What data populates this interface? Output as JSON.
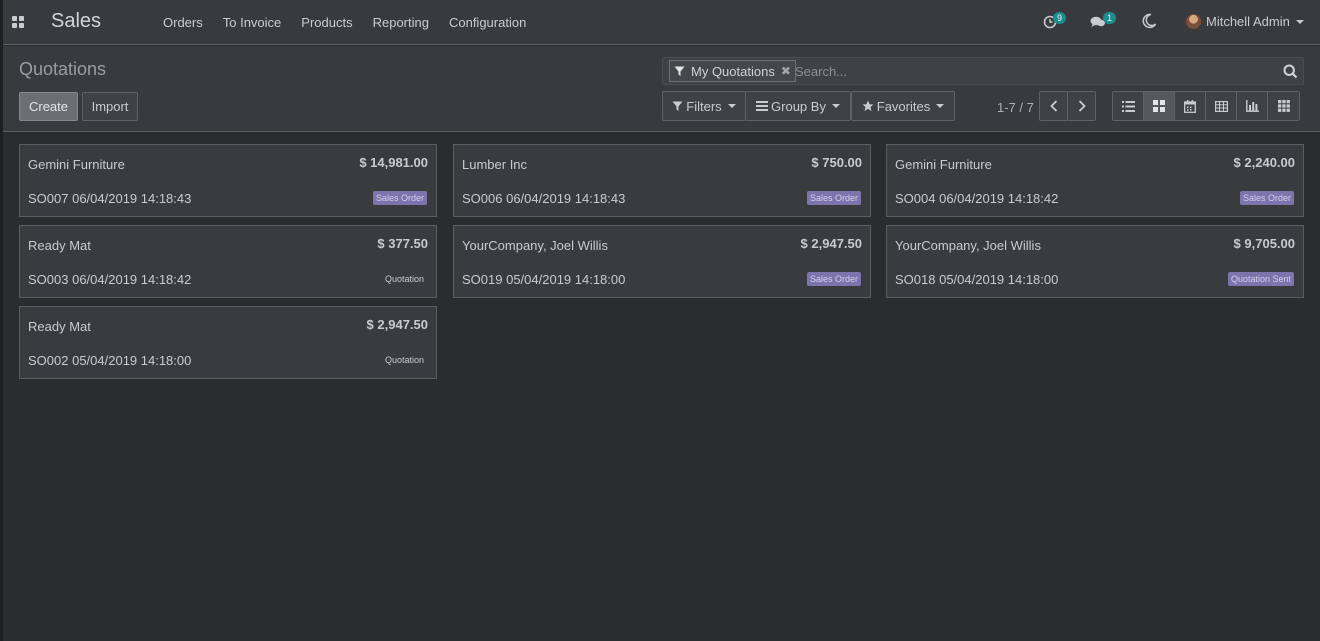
{
  "navbar": {
    "brand": "Sales",
    "menu": [
      "Orders",
      "To Invoice",
      "Products",
      "Reporting",
      "Configuration"
    ],
    "activities_count": "9",
    "messages_count": "1",
    "user_name": "Mitchell Admin"
  },
  "control_panel": {
    "breadcrumb": "Quotations",
    "create_label": "Create",
    "import_label": "Import",
    "search": {
      "facet_label": "My Quotations",
      "placeholder": "Search..."
    },
    "filters_label": "Filters",
    "groupby_label": "Group By",
    "favorites_label": "Favorites",
    "pager_value": "1-7 / 7"
  },
  "cards": [
    {
      "customer": "Gemini Furniture",
      "amount": "$ 14,981.00",
      "ref": "SO007 06/04/2019 14:18:43",
      "state": "Sales Order"
    },
    {
      "customer": "Lumber Inc",
      "amount": "$ 750.00",
      "ref": "SO006 06/04/2019 14:18:43",
      "state": "Sales Order"
    },
    {
      "customer": "Gemini Furniture",
      "amount": "$ 2,240.00",
      "ref": "SO004 06/04/2019 14:18:42",
      "state": "Sales Order"
    },
    {
      "customer": "Ready Mat",
      "amount": "$ 377.50",
      "ref": "SO003 06/04/2019 14:18:42",
      "state": "Quotation"
    },
    {
      "customer": "YourCompany, Joel Willis",
      "amount": "$ 2,947.50",
      "ref": "SO019 05/04/2019 14:18:00",
      "state": "Sales Order"
    },
    {
      "customer": "YourCompany, Joel Willis",
      "amount": "$ 9,705.00",
      "ref": "SO018 05/04/2019 14:18:00",
      "state": "Quotation Sent"
    },
    {
      "customer": "Ready Mat",
      "amount": "$ 2,947.50",
      "ref": "SO002 05/04/2019 14:18:00",
      "state": "Quotation"
    }
  ]
}
